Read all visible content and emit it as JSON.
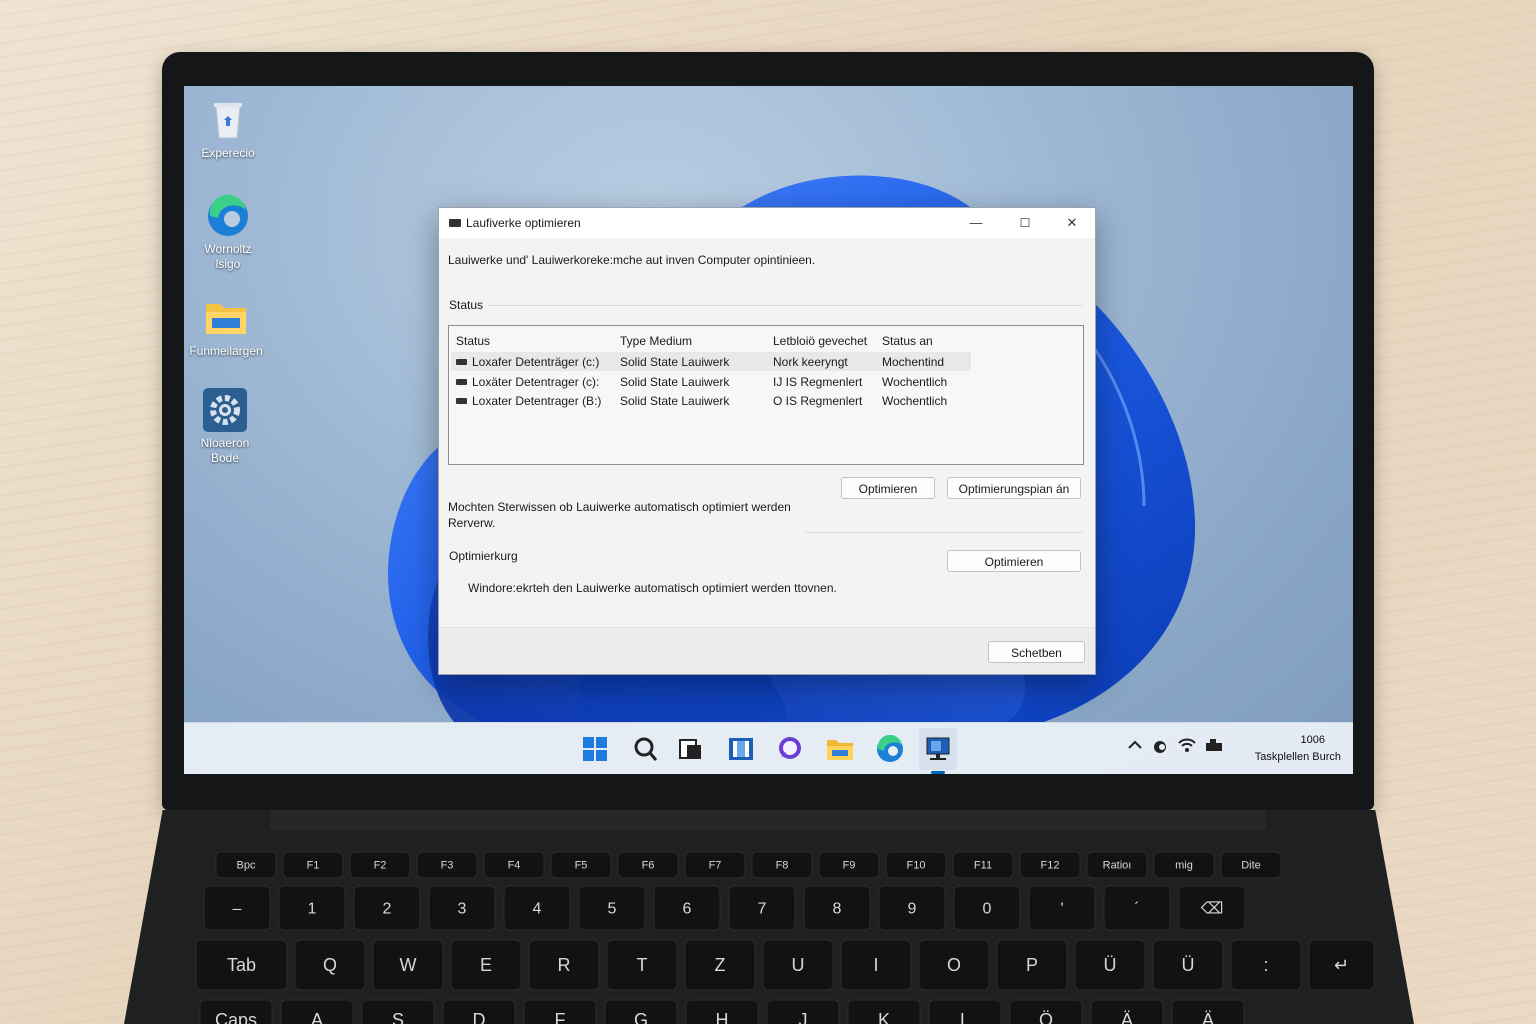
{
  "desktop": {
    "icons": [
      {
        "label_line1": "Experecio",
        "label_line2": ""
      },
      {
        "label_line1": "Wornoltz",
        "label_line2": "lsigo"
      },
      {
        "label_line1": "Funmeilargen",
        "label_line2": ""
      },
      {
        "label_line1": "Nloaeron",
        "label_line2": "Bode"
      }
    ]
  },
  "window": {
    "title": "Laufiverke optimieren",
    "controls": {
      "minimize": "—",
      "maximize": "☐",
      "close": "✕"
    },
    "description": "Lauiwerke und' Lauiwerkoreke:mche aut inven Computer opintinieen.",
    "status_label": "Status",
    "columns": [
      "Status",
      "Type Medium",
      "Letbloiö gevechet",
      "Status an"
    ],
    "rows": [
      {
        "name": "Loxafer Detenträger (c:)",
        "media": "Solid State Lauiwerk",
        "last": "Nork keeryngt",
        "status": "Mochentind"
      },
      {
        "name": "Loxäter Detentrager (c):",
        "media": "Solid State Lauiwerk",
        "last": "IJ IS Regmenlert",
        "status": "Wochentlich"
      },
      {
        "name": "Loxater Detentrager (B:)",
        "media": "Solid State Lauiwerk",
        "last": "O IS Regmenlert",
        "status": "Wochentlich"
      }
    ],
    "buttons": {
      "optimize": "Optimieren",
      "schedule": "Optimierungspian án",
      "optimize2": "Optimieren",
      "close": "Schetben"
    },
    "question_line1": "Mochten Sterwissen ob Lauiwerke automatisch optimiert werden",
    "question_line2": "Rerverw.",
    "optimization_label": "Optimierkurg",
    "optimization_text": "Windore:ekrteh den Lauiwerke automatisch optimiert werden ttovnen."
  },
  "taskbar": {
    "icons": [
      "windows-start-icon",
      "search-icon",
      "task-view-icon",
      "widgets-icon",
      "chat-icon",
      "file-explorer-icon",
      "edge-icon",
      "defrag-app-icon"
    ],
    "clock_time": "1006",
    "clock_label": "Taskplellen Burch"
  },
  "keyboard": {
    "fn_row": [
      "Bpc",
      "F1",
      "F2",
      "F3",
      "F4",
      "F5",
      "F6",
      "F7",
      "F8",
      "F9",
      "F10",
      "F11",
      "F12",
      "Ratioı",
      "mig",
      "Dite"
    ],
    "num_row": [
      "–",
      "1",
      "2",
      "3",
      "4",
      "5",
      "6",
      "7",
      "8",
      "9",
      "0",
      "'",
      "´",
      "⌫"
    ],
    "alpha_row": [
      "Tab",
      "Q",
      "W",
      "E",
      "R",
      "T",
      "Z",
      "U",
      "I",
      "O",
      "P",
      "Ü",
      "Ü",
      ":",
      "↵"
    ],
    "bottom_row": [
      "Caps",
      "A",
      "S",
      "D",
      "F",
      "G",
      "H",
      "J",
      "K",
      "L",
      "Ö",
      "Ä",
      "Ä"
    ]
  },
  "colors": {
    "accent": "#0067c0",
    "bloom": "#1e5ee8",
    "window_bg": "#f3f3f3"
  }
}
